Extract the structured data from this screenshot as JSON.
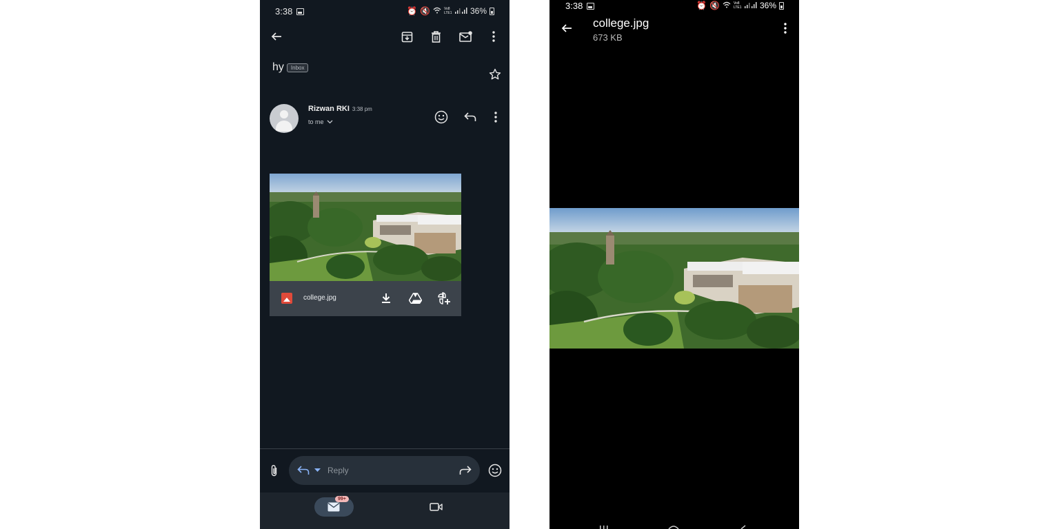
{
  "left_phone": {
    "status": {
      "time": "3:38",
      "battery": "36%",
      "net": "Vo8 LTE1"
    },
    "subject": {
      "title": "hy",
      "label": "Inbox"
    },
    "sender": {
      "name": "Rizwan RKI",
      "time": "3:38 pm",
      "recipient": "to me"
    },
    "attachment": {
      "filename": "college.jpg"
    },
    "reply": {
      "placeholder": "Reply"
    },
    "bottom_nav": {
      "mail_badge": "99+"
    }
  },
  "right_phone": {
    "status": {
      "time": "3:38",
      "battery": "36%",
      "net": "Vo8 LTE1"
    },
    "viewer": {
      "filename": "college.jpg",
      "size": "673 KB"
    }
  },
  "colors": {
    "accent_blue": "#8ab4f8",
    "attachment_red": "#e04a3a",
    "badge_pink": "#f3b8b8"
  },
  "icons": [
    "back-arrow-icon",
    "archive-icon",
    "delete-icon",
    "mark-unread-icon",
    "more-vert-icon",
    "star-icon",
    "emoji-icon",
    "reply-icon",
    "download-icon",
    "drive-icon",
    "add-to-photos-icon",
    "attach-icon",
    "forward-icon",
    "mail-icon",
    "video-icon"
  ]
}
